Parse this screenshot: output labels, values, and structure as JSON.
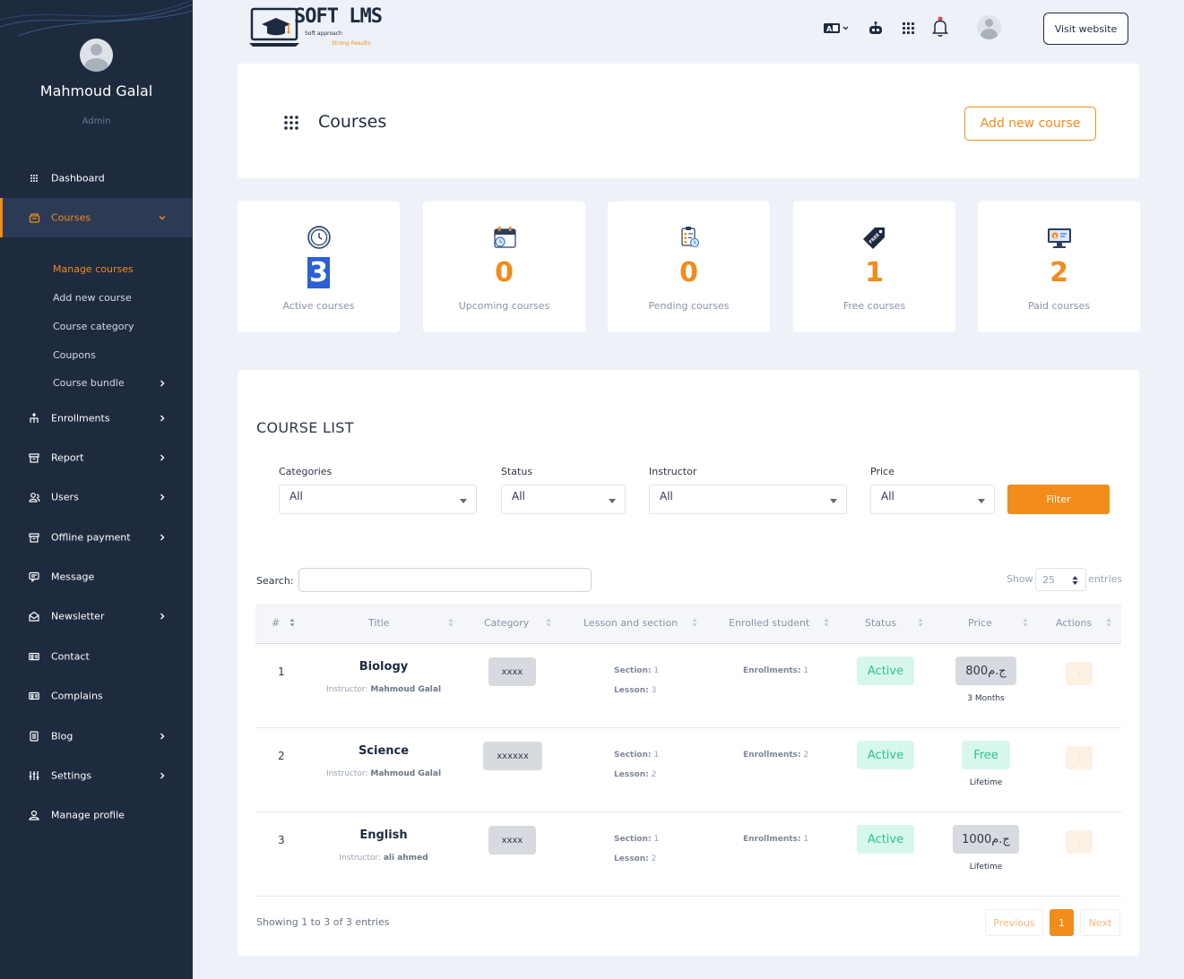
{
  "sidebar": {
    "user_name": "Mahmoud Galal",
    "user_role": "Admin",
    "items": [
      {
        "label": "Dashboard",
        "icon": "dashboard-grid-icon"
      },
      {
        "label": "Courses",
        "icon": "courses-icon",
        "active": true
      },
      {
        "label": "Enrollments",
        "icon": "enrollments-icon"
      },
      {
        "label": "Report",
        "icon": "report-icon"
      },
      {
        "label": "Users",
        "icon": "users-icon"
      },
      {
        "label": "Offline payment",
        "icon": "offline-payment-icon"
      },
      {
        "label": "Message",
        "icon": "message-icon"
      },
      {
        "label": "Newsletter",
        "icon": "newsletter-icon"
      },
      {
        "label": "Contact",
        "icon": "contact-icon"
      },
      {
        "label": "Complains",
        "icon": "complains-icon"
      },
      {
        "label": "Blog",
        "icon": "blog-icon"
      },
      {
        "label": "Settings",
        "icon": "settings-icon"
      },
      {
        "label": "Manage profile",
        "icon": "profile-icon"
      }
    ],
    "courses_sub": [
      {
        "label": "Manage courses",
        "active": true
      },
      {
        "label": "Add new course"
      },
      {
        "label": "Course category"
      },
      {
        "label": "Coupons"
      },
      {
        "label": "Course bundle"
      }
    ]
  },
  "topbar": {
    "logo_main": "SOFT LMS",
    "logo_tag1": "Soft approach",
    "logo_tag2": "Strong Results",
    "visit_website": "Visit website"
  },
  "header": {
    "title": "Courses",
    "add_course_button": "Add new course"
  },
  "stats": [
    {
      "value": "3",
      "label": "Active courses",
      "icon": "clock-icon"
    },
    {
      "value": "0",
      "label": "Upcoming courses",
      "icon": "calendar-icon"
    },
    {
      "value": "0",
      "label": "Pending courses",
      "icon": "clipboard-icon"
    },
    {
      "value": "1",
      "label": "Free courses",
      "icon": "free-tag-icon"
    },
    {
      "value": "2",
      "label": "Paid courses",
      "icon": "paid-monitor-icon"
    }
  ],
  "course_list": {
    "title": "COURSE LIST",
    "filters": {
      "categories_label": "Categories",
      "categories_value": "All",
      "status_label": "Status",
      "status_value": "All",
      "instructor_label": "Instructor",
      "instructor_value": "All",
      "price_label": "Price",
      "price_value": "All",
      "filter_button": "Filter"
    },
    "search_label": "Search:",
    "show_label": "Show",
    "show_value": "25",
    "entries_label": "entries",
    "columns": [
      "#",
      "Title",
      "Category",
      "Lesson and section",
      "Enrolled student",
      "Status",
      "Price",
      "Actions"
    ],
    "rows": [
      {
        "num": "1",
        "title": "Biology",
        "instructor_label": "Instructor:",
        "instructor": "Mahmoud Galal",
        "category": "xxxx",
        "section_label": "Section:",
        "section": "1",
        "lesson_label": "Lesson:",
        "lesson": "3",
        "enroll_label": "Enrollments:",
        "enroll": "1",
        "status": "Active",
        "price": "800ج.م",
        "price_type": "paid",
        "duration": "3 Months"
      },
      {
        "num": "2",
        "title": "Science",
        "instructor_label": "Instructor:",
        "instructor": "Mahmoud Galal",
        "category": "xxxxxx",
        "section_label": "Section:",
        "section": "1",
        "lesson_label": "Lesson:",
        "lesson": "2",
        "enroll_label": "Enrollments:",
        "enroll": "2",
        "status": "Active",
        "price": "Free",
        "price_type": "free",
        "duration": "Lifetime"
      },
      {
        "num": "3",
        "title": "English",
        "instructor_label": "Instructor:",
        "instructor": "ali ahmed",
        "category": "xxxx",
        "section_label": "Section:",
        "section": "1",
        "lesson_label": "Lesson:",
        "lesson": "2",
        "enroll_label": "Enrollments:",
        "enroll": "1",
        "status": "Active",
        "price": "1000ج.م",
        "price_type": "paid",
        "duration": "Lifetime"
      }
    ],
    "action_glyph": "⋮",
    "showing_text": "Showing 1 to 3 of 3 entries",
    "pagination": {
      "previous": "Previous",
      "current": "1",
      "next": "Next"
    }
  },
  "colors": {
    "accent": "#f28c1b",
    "sidebar_bg": "#1e2a3e",
    "active_green": "#2bc48a",
    "page_bg": "#eef2f8"
  }
}
